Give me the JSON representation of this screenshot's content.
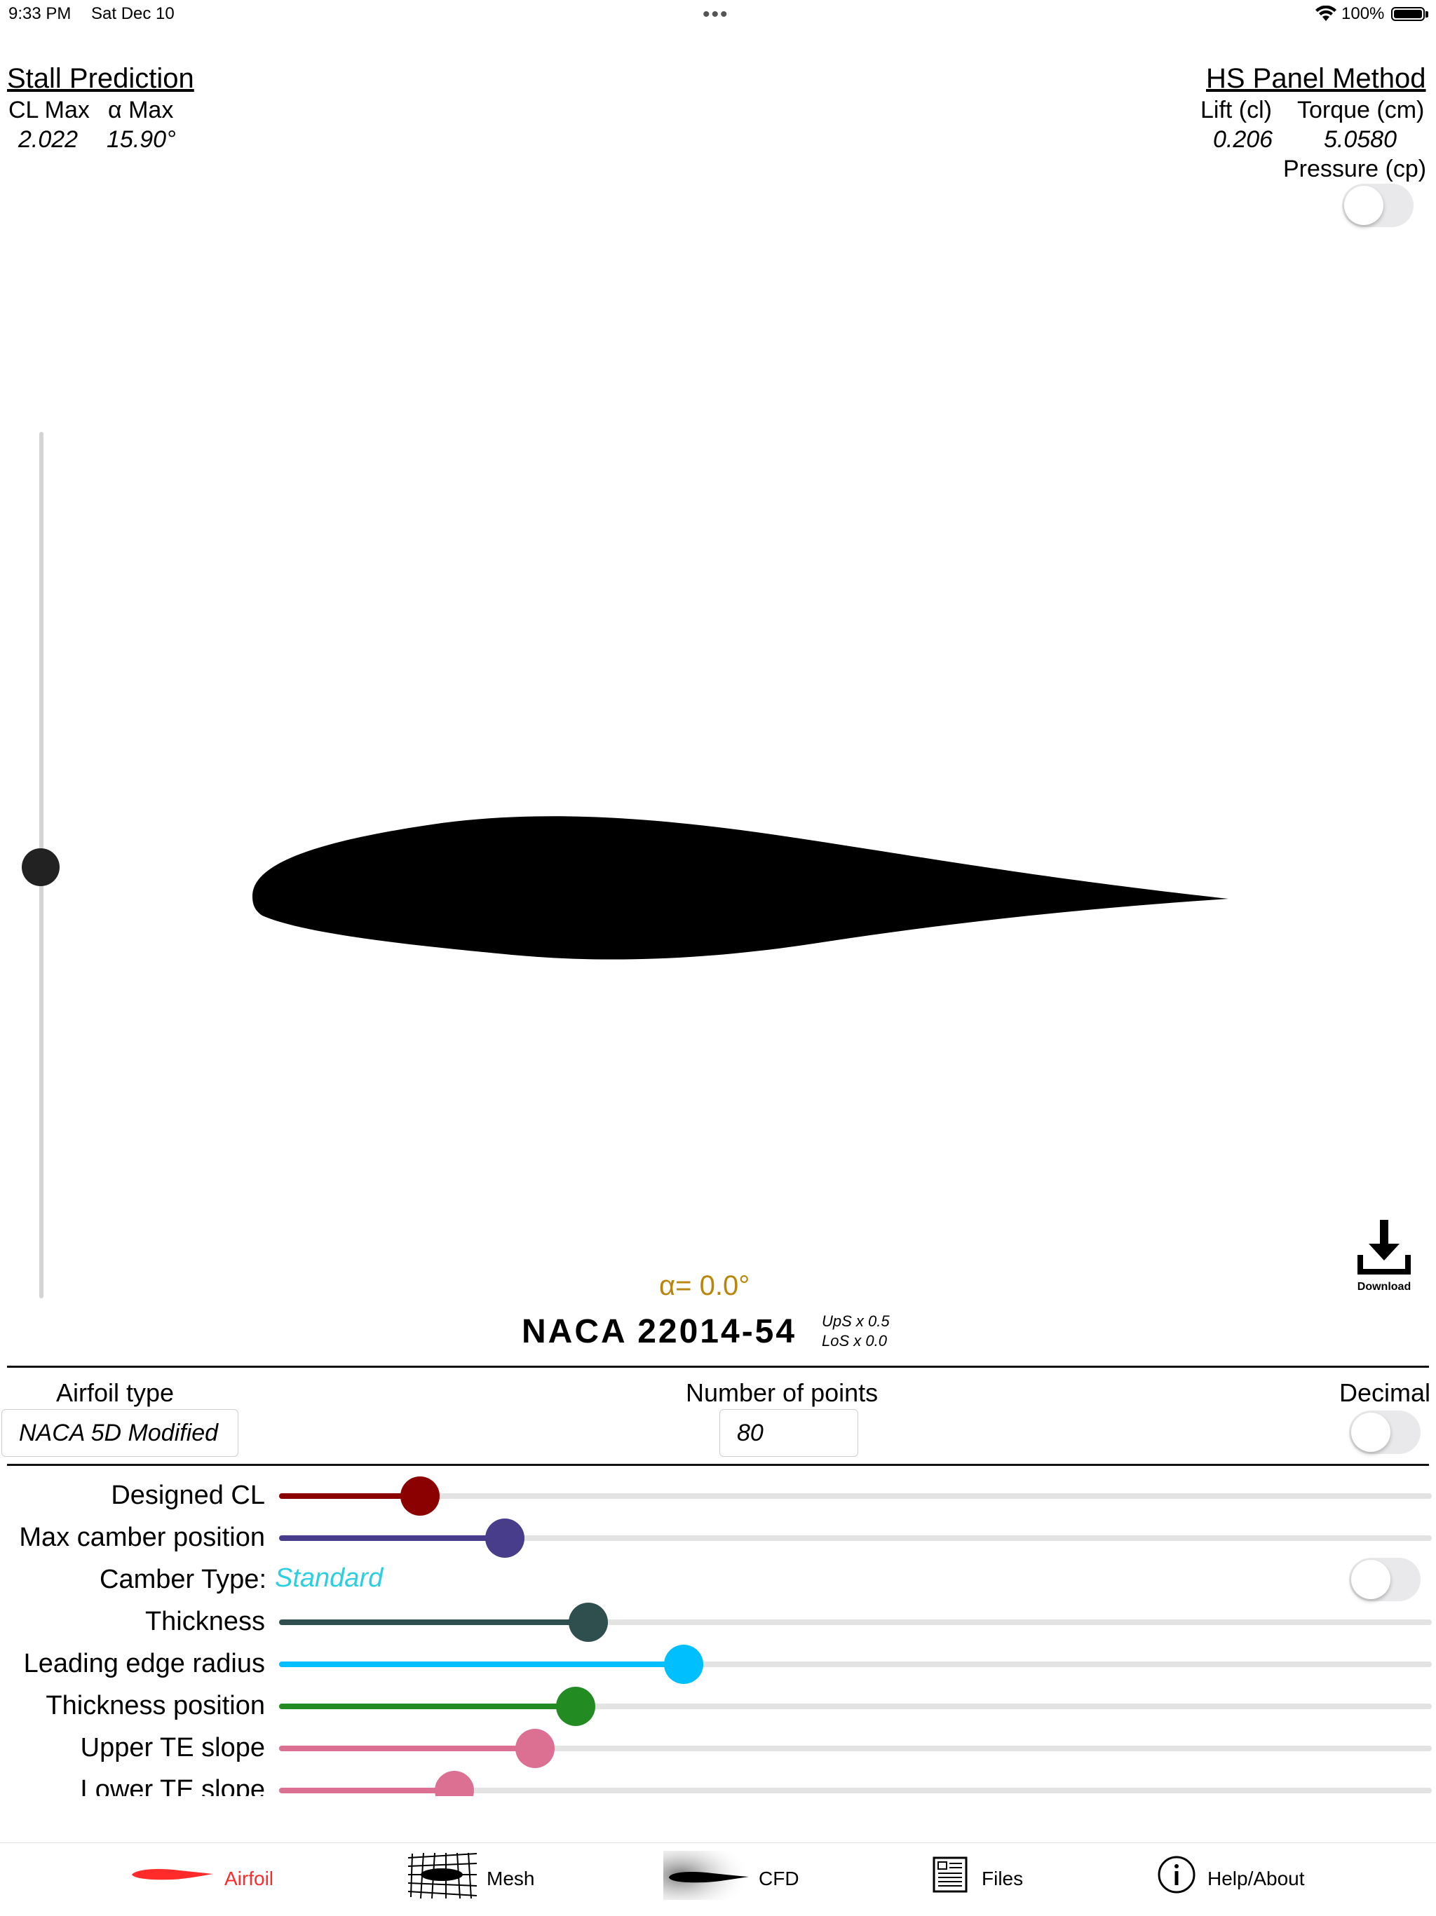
{
  "status_bar": {
    "time": "9:33 PM",
    "date": "Sat Dec 10",
    "battery": "100%"
  },
  "stall": {
    "title": "Stall Prediction",
    "cl_max_label": "CL Max",
    "alpha_max_label": "α Max",
    "cl_max_value": "2.022",
    "alpha_max_value": "15.90°"
  },
  "panel": {
    "title": "HS Panel Method",
    "lift_label": "Lift (cl)",
    "torque_label": "Torque (cm)",
    "lift_value": "0.206",
    "torque_value": "5.0580",
    "pressure_label": "Pressure (cp)",
    "pressure_on": false
  },
  "alpha": {
    "label": "α= 0.0°",
    "value_deg": 0.0
  },
  "naca": {
    "name": "NACA 22014-54",
    "ups": "UpS x 0.5",
    "los": "LoS x 0.0"
  },
  "download_label": "Download",
  "airfoil_type": {
    "label": "Airfoil type",
    "value": "NACA 5D Modified"
  },
  "num_points": {
    "label": "Number of points",
    "value": "80"
  },
  "decimal": {
    "label": "Decimal",
    "on": false
  },
  "camber_type": {
    "label": "Camber Type:",
    "value": "Standard",
    "value_color": "#2ccfe0"
  },
  "sliders": [
    {
      "label": "Designed CL",
      "fraction": 0.122,
      "color": "#8b0000"
    },
    {
      "label": "Max camber position",
      "fraction": 0.196,
      "color": "#483d8b"
    },
    {
      "label": "Thickness",
      "fraction": 0.268,
      "color": "#2f4f4f"
    },
    {
      "label": "Leading edge radius",
      "fraction": 0.351,
      "color": "#00bfff"
    },
    {
      "label": "Thickness position",
      "fraction": 0.257,
      "color": "#228b22"
    },
    {
      "label": "Upper TE slope",
      "fraction": 0.222,
      "color": "#db7093"
    },
    {
      "label": "Lower TE slope",
      "fraction": 0.152,
      "color": "#db7093"
    }
  ],
  "tabs": [
    {
      "label": "Airfoil",
      "icon": "airfoil-icon",
      "active": true
    },
    {
      "label": "Mesh",
      "icon": "mesh-icon",
      "active": false
    },
    {
      "label": "CFD",
      "icon": "cfd-icon",
      "active": false
    },
    {
      "label": "Files",
      "icon": "files-icon",
      "active": false
    },
    {
      "label": "Help/About",
      "icon": "info-icon",
      "active": false
    }
  ],
  "colors": {
    "active_tab": "#ff2a2a",
    "alpha_label": "#b8860b"
  }
}
